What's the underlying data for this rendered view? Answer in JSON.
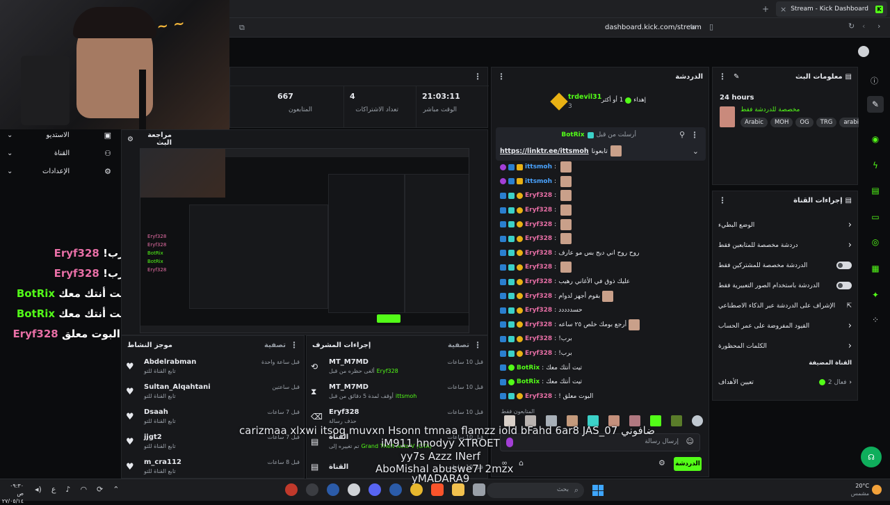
{
  "browser": {
    "tab_title": "Stream - Kick Dashboard",
    "url": "dashboard.kick.com/stream"
  },
  "stats": [
    {
      "value": "667",
      "label": "المتابعون"
    },
    {
      "value": "4",
      "label": "تعداد الاشتراكات"
    },
    {
      "value": "21:03:11",
      "label": "الوقت مباشر"
    }
  ],
  "left_menu": [
    {
      "label": "الاستديو"
    },
    {
      "label": "القناة"
    },
    {
      "label": "الإعدادات"
    }
  ],
  "preview_panel": {
    "title": "مراجعة البث"
  },
  "big_chat": [
    {
      "user": "Eryf328",
      "text": "برب!",
      "color": "#e86fa6"
    },
    {
      "user": "Eryf328",
      "text": "برب!",
      "color": "#e86fa6"
    },
    {
      "user": "BotRix",
      "text": "تيت أنتك معك",
      "color": "#53fc18"
    },
    {
      "user": "BotRix",
      "text": "تيت أنتك معك",
      "color": "#53fc18"
    },
    {
      "user": "Eryf328",
      "text": "! البوت معلق",
      "color": "#e86fa6"
    }
  ],
  "activity_feed": {
    "title": "موجز النشاط",
    "filter": "تصفية",
    "items": [
      {
        "user": "Abdelrabman",
        "time": "قبل ساعة واحدة",
        "desc": "تابع القناة للتو"
      },
      {
        "user": "Sultan_Alqahtani",
        "time": "قبل ساعتين",
        "desc": "تابع القناة للتو"
      },
      {
        "user": "Dsaah",
        "time": "قبل 7 ساعات",
        "desc": "تابع القناة للتو"
      },
      {
        "user": "jjgt2",
        "time": "قبل 7 ساعات",
        "desc": "تابع القناة للتو"
      },
      {
        "user": "m_cra112",
        "time": "قبل 8 ساعات",
        "desc": "تابع القناة للتو"
      }
    ]
  },
  "mod_actions": {
    "title": "إجراءات المشرف",
    "filter": "تصفية",
    "items": [
      {
        "user": "MT_M7MD",
        "time": "قبل 10 ساعات",
        "desc": "ألغى حظره من قبل",
        "target": "Eryf328"
      },
      {
        "user": "MT_M7MD",
        "time": "قبل 10 ساعات",
        "desc": "أوقف لمدة 5 دقائق من قبل",
        "target": "ittsmoh"
      },
      {
        "user": "Eryf328",
        "time": "قبل 10 ساعات",
        "desc": "حذف رسالة",
        "target": ""
      },
      {
        "user": "القناة",
        "time": "قبل 10 ساعات",
        "desc": "تم تغييره إلى",
        "target": "Grand Theft Auto V (GTA)"
      },
      {
        "user": "القناة",
        "time": "قبل 10 ساعات",
        "desc": "",
        "target": ""
      }
    ]
  },
  "chat": {
    "title": "الدردشة",
    "pinned_user": "trdevil31",
    "pinned_count": "3",
    "gift_text": "إهداء",
    "gift_more": "أو أكثر",
    "gift_num": "1",
    "pinned_msg_from": "أرسلت من قبل",
    "pinned_msg_user": "BotRix",
    "pinned_link": "https://linktr.ee/ittsmoh",
    "pinned_link_suffix": "تابعونا",
    "messages": [
      {
        "user": "ittsmoh",
        "text": "",
        "color": "#4aa3ff"
      },
      {
        "user": "ittsmoh",
        "text": "",
        "color": "#4aa3ff"
      },
      {
        "user": "Eryf328",
        "text": "",
        "color": "#e86fa6"
      },
      {
        "user": "Eryf328",
        "text": "",
        "color": "#e86fa6"
      },
      {
        "user": "Eryf328",
        "text": "",
        "color": "#e86fa6"
      },
      {
        "user": "Eryf328",
        "text": "",
        "color": "#e86fa6"
      },
      {
        "user": "Eryf328",
        "text": "روح روح اني ديج بس مو عارف",
        "color": "#e86fa6"
      },
      {
        "user": "Eryf328",
        "text": "",
        "color": "#e86fa6"
      },
      {
        "user": "Eryf328",
        "text": "عليك ذوق في الأغاني رهيب",
        "color": "#e86fa6"
      },
      {
        "user": "Eryf328",
        "text": "بقوم أجهز لدوام",
        "color": "#e86fa6"
      },
      {
        "user": "Eryf328",
        "text": "حسددددد",
        "color": "#e86fa6"
      },
      {
        "user": "Eryf328",
        "text": "أرجع بومك خلص ٢٥ ساعه",
        "color": "#e86fa6"
      },
      {
        "user": "Eryf328",
        "text": "برب!",
        "color": "#e86fa6"
      },
      {
        "user": "Eryf328",
        "text": "برب!",
        "color": "#e86fa6"
      },
      {
        "user": "BotRix",
        "text": "تيت أنتك معك",
        "color": "#53fc18"
      },
      {
        "user": "BotRix",
        "text": "تيت أنتك معك",
        "color": "#53fc18"
      },
      {
        "user": "Eryf328",
        "text": "البوت معلق !",
        "color": "#e86fa6"
      }
    ],
    "followers_only": "المتابعون فقط",
    "input_placeholder": "إرسال رسالة",
    "send_label": "الدردشة"
  },
  "stream_info": {
    "title": "معلومات البث",
    "duration": "24 hours",
    "subtitle": "مخصصة للدردشة فقط",
    "tags": [
      "Arabic",
      "MOH",
      "OG",
      "TRG",
      "arabi"
    ]
  },
  "channel_actions": {
    "title": "إجراءات القناة",
    "items": [
      {
        "label": "الوضع البطيء",
        "control": "chevron"
      },
      {
        "label": "دردشة مخصصة للمتابعين فقط",
        "control": "chevron"
      },
      {
        "label": "الدردشة مخصصة للمشتركين فقط",
        "control": "toggle"
      },
      {
        "label": "الدردشة باستخدام الصور التعبيرية فقط",
        "control": "toggle"
      },
      {
        "label": "الإشراف على الدردشة عبر الذكاء الاصطناعي",
        "control": "external"
      },
      {
        "label": "القيود المفروضة على عمر الحساب",
        "control": "chevron"
      },
      {
        "label": "الكلمات المحظورة",
        "control": "chevron"
      }
    ],
    "section": "القناة المضيفة",
    "goals_label": "تعيين الأهداف",
    "goals_value": "فعال 2"
  },
  "overlay_text": [
    "carizmaa xlxwi itsog muvxn Hsonn tmnaa flamzz iold bFahd 6ar8 JAS_07 ضافوني",
    "iM911 hnodyy XTROET",
    "yy7s Azzz INerf",
    "AboMishal abuswe7l 2mzx",
    "yMADARA9"
  ],
  "taskbar": {
    "search": "بحث",
    "weather": "20°C",
    "weather_desc": "مشمس",
    "time": "٠٩:٣٠ ص",
    "date": "٢٧/٠٥/١٤"
  }
}
